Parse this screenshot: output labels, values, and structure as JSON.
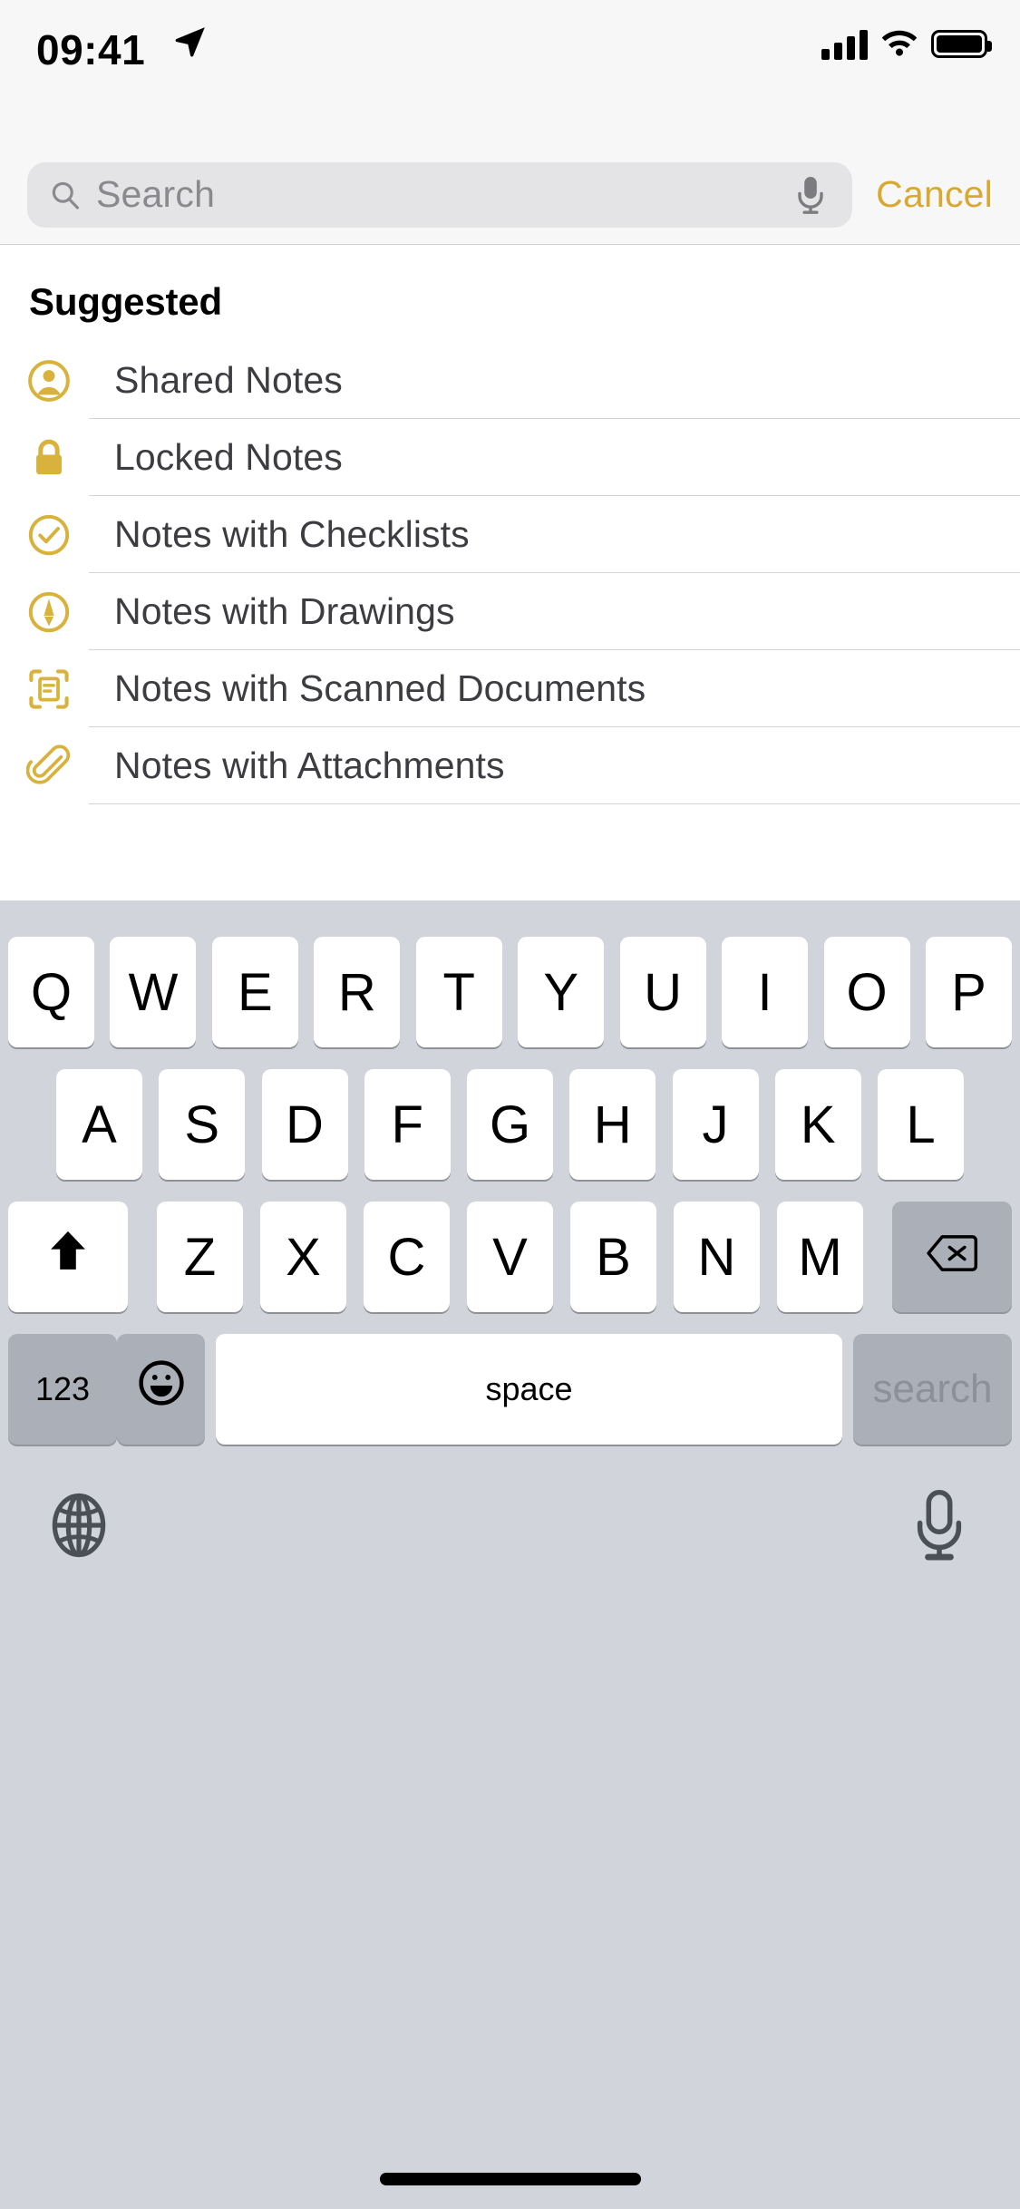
{
  "status_bar": {
    "time": "09:41",
    "location_icon": "location-arrow-icon",
    "cellular_icon": "cellular-bars-icon",
    "wifi_icon": "wifi-icon",
    "battery_icon": "battery-full-icon"
  },
  "search": {
    "placeholder": "Search",
    "value": "",
    "search_icon": "search-icon",
    "dictation_icon": "microphone-icon",
    "cancel_label": "Cancel",
    "accent_color": "#D8A930"
  },
  "suggested": {
    "title": "Suggested",
    "items": [
      {
        "label": "Shared Notes",
        "icon": "person-circle-icon"
      },
      {
        "label": "Locked Notes",
        "icon": "lock-icon"
      },
      {
        "label": "Notes with Checklists",
        "icon": "checkmark-circle-icon"
      },
      {
        "label": "Notes with Drawings",
        "icon": "pen-circle-icon"
      },
      {
        "label": "Notes with Scanned Documents",
        "icon": "document-scanner-icon"
      },
      {
        "label": "Notes with Attachments",
        "icon": "paperclip-icon"
      }
    ]
  },
  "keyboard": {
    "row1": [
      "Q",
      "W",
      "E",
      "R",
      "T",
      "Y",
      "U",
      "I",
      "O",
      "P"
    ],
    "row2": [
      "A",
      "S",
      "D",
      "F",
      "G",
      "H",
      "J",
      "K",
      "L"
    ],
    "row3_letters": [
      "Z",
      "X",
      "C",
      "V",
      "B",
      "N",
      "M"
    ],
    "shift_icon": "shift-up-arrow-icon",
    "backspace_icon": "delete-left-icon",
    "numbers_label": "123",
    "emoji_icon": "smiley-face-icon",
    "space_label": "space",
    "return_label": "search",
    "globe_icon": "globe-icon",
    "dictation_icon": "microphone-icon"
  },
  "home_indicator": "home-indicator-bar"
}
